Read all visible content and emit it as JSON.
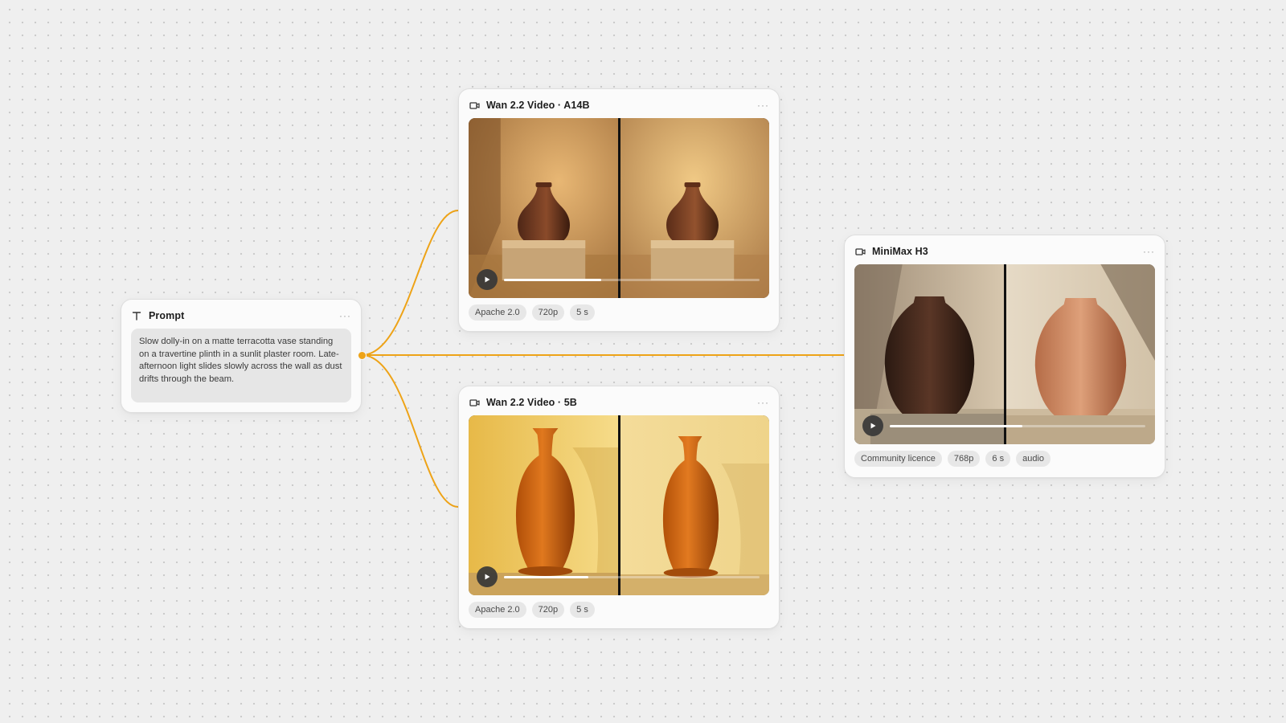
{
  "theme": {
    "accent": "#eea317",
    "canvas": "#efefef",
    "card": "#fbfbfb"
  },
  "prompt_node": {
    "title": "Prompt",
    "icon": "text-type-icon",
    "menu": "···",
    "text": "Slow dolly-in on a matte terracotta vase standing on a travertine plinth in a sunlit plaster room. Late-afternoon light slides slowly across the wall as dust drifts through the beam."
  },
  "video_nodes": {
    "a14b": {
      "title": "Wan 2.2 Video · A14B",
      "icon": "video-camera-icon",
      "menu": "···",
      "progress": 0.38,
      "tags": [
        "Apache 2.0",
        "720p",
        "5 s"
      ]
    },
    "b5": {
      "title": "Wan 2.2 Video · 5B",
      "icon": "video-camera-icon",
      "menu": "···",
      "progress": 0.33,
      "tags": [
        "Apache 2.0",
        "720p",
        "5 s"
      ]
    },
    "minimax": {
      "title": "MiniMax H3",
      "icon": "video-camera-icon",
      "menu": "···",
      "progress": 0.52,
      "tags": [
        "Community licence",
        "768p",
        "6 s",
        "audio"
      ]
    }
  }
}
